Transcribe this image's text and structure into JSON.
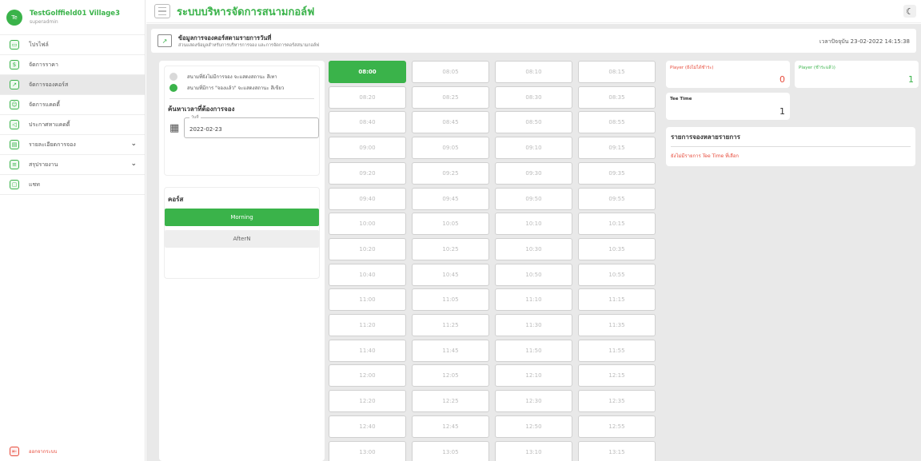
{
  "sidebar": {
    "avatar_text": "Te",
    "username": "TestGolffield01 Village3",
    "role": "superadmin",
    "items": [
      {
        "label": "โปรไฟล์",
        "icon": "profile-icon",
        "glyph": "▭"
      },
      {
        "label": "จัดการราคา",
        "icon": "price-icon",
        "glyph": "$"
      },
      {
        "label": "จัดการจองคอร์ส",
        "icon": "chart-icon",
        "glyph": "↗"
      },
      {
        "label": "จัดการแคดดี้",
        "icon": "caddie-icon",
        "glyph": "☺"
      },
      {
        "label": "ประกาศหาแคดดี้",
        "icon": "announce-icon",
        "glyph": "◁"
      },
      {
        "label": "รายละเอียดการจอง",
        "icon": "booking-detail-icon",
        "glyph": "▤"
      },
      {
        "label": "สรุปรายงาน",
        "icon": "report-icon",
        "glyph": "≡"
      },
      {
        "label": "แชท",
        "icon": "chat-icon",
        "glyph": "▢"
      }
    ],
    "logout_label": "ออกจากระบบ"
  },
  "header": {
    "title": "ระบบบริหารจัดการสนามกอล์ฟ"
  },
  "subheader": {
    "title": "ข้อมูลการจองคอร์สตามรายการวันที่",
    "description": "ส่วนแสดงข้อมูลสำหรับการบริหารการจอง และการจัดการคอร์สสนามกอล์ฟ",
    "current_time": "เวลาปัจจุบัน 23-02-2022 14:15:38"
  },
  "legend": {
    "not_booked": "สนามที่ยังไม่มีการจอง จะแสดงสถานะ สีเทา",
    "booked": "สนามที่มีการ \"จองแล้ว\" จะแสดงสถานะ สีเขียว",
    "grey_color": "#d9d9d9",
    "green_color": "#3ab34a"
  },
  "search": {
    "title": "ค้นหาเวลาที่ต้องการจอง",
    "date_label": "วันที่",
    "date_value": "2022-02-23"
  },
  "course": {
    "title": "คอร์ส",
    "options": [
      "Morning",
      "AfterN"
    ],
    "selected": "Morning"
  },
  "time_slots": [
    "08:00",
    "08:05",
    "08:10",
    "08:15",
    "08:20",
    "08:25",
    "08:30",
    "08:35",
    "08:40",
    "08:45",
    "08:50",
    "08:55",
    "09:00",
    "09:05",
    "09:10",
    "09:15",
    "09:20",
    "09:25",
    "09:30",
    "09:35",
    "09:40",
    "09:45",
    "09:50",
    "09:55",
    "10:00",
    "10:05",
    "10:10",
    "10:15",
    "10:20",
    "10:25",
    "10:30",
    "10:35",
    "10:40",
    "10:45",
    "10:50",
    "10:55",
    "11:00",
    "11:05",
    "11:10",
    "11:15",
    "11:20",
    "11:25",
    "11:30",
    "11:35",
    "11:40",
    "11:45",
    "11:50",
    "11:55",
    "12:00",
    "12:05",
    "12:10",
    "12:15",
    "12:20",
    "12:25",
    "12:30",
    "12:35",
    "12:40",
    "12:45",
    "12:50",
    "12:55",
    "13:00",
    "13:05",
    "13:10",
    "13:15"
  ],
  "selected_slot": "08:00",
  "stats": {
    "unpaid_label": "Player (ยังไม่ได้ชำระ)",
    "unpaid_value": "0",
    "paid_label": "Player (ชำระแล้ว)",
    "paid_value": "1",
    "teetime_label": "Tee Time",
    "teetime_value": "1"
  },
  "booking_list": {
    "title": "รายการจองหลายรายการ",
    "empty_text": "ยังไม่มีรายการ Tee Time ที่เลือก"
  },
  "colors": {
    "accent": "#3ab34a",
    "danger": "#e74c3c"
  }
}
